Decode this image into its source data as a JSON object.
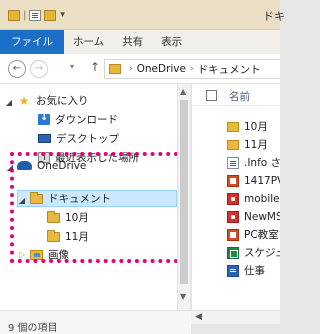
{
  "window": {
    "title": "ドキ"
  },
  "quick_access_toolbar": {
    "dropdown_glyph": "▾"
  },
  "ribbon": {
    "file_tab": "ファイル",
    "tabs": [
      "ホーム",
      "共有",
      "表示"
    ]
  },
  "address_bar": {
    "back_glyph": "←",
    "forward_glyph": "→",
    "up_glyph": "↑",
    "path": [
      "OneDrive",
      "ドキュメント"
    ],
    "separator": "›"
  },
  "nav_pane": {
    "favorites": {
      "label": "お気に入り",
      "icon": "star-icon"
    },
    "favorites_items": [
      {
        "label": "ダウンロード",
        "icon": "download-icon"
      },
      {
        "label": "デスクトップ",
        "icon": "desktop-icon"
      },
      {
        "label": "最近表示した場所",
        "icon": "recent-places-icon"
      }
    ],
    "onedrive": {
      "label": "OneDrive",
      "icon": "onedrive-cloud-icon"
    },
    "documents": {
      "label": "ドキュメント",
      "icon": "folder-icon",
      "selected": true
    },
    "documents_children": [
      {
        "label": "10月",
        "icon": "folder-icon"
      },
      {
        "label": "11月",
        "icon": "folder-icon"
      }
    ],
    "pictures": {
      "label": "画像",
      "icon": "pictures-folder-icon"
    }
  },
  "file_pane": {
    "column_name": "名前",
    "items": [
      {
        "label": "10月",
        "icon": "folder-icon"
      },
      {
        "label": "11月",
        "icon": "folder-icon"
      },
      {
        "label": ".Info さ",
        "icon": "document-icon"
      },
      {
        "label": "1417PV",
        "icon": "powerpoint-icon"
      },
      {
        "label": "mobile",
        "icon": "red-file-icon"
      },
      {
        "label": "NewMS",
        "icon": "red-file-icon"
      },
      {
        "label": "PC教室",
        "icon": "powerpoint-icon"
      },
      {
        "label": "スケジュ",
        "icon": "excel-icon"
      },
      {
        "label": "仕事",
        "icon": "word-icon"
      }
    ]
  },
  "status_bar": {
    "text": "9 個の項目"
  },
  "annotation": {
    "highlight_color": "#e3007f"
  },
  "colors": {
    "file_tab": "#1c6fc7",
    "selection": "#cce8ff",
    "title_bar": "#eadfc4"
  }
}
